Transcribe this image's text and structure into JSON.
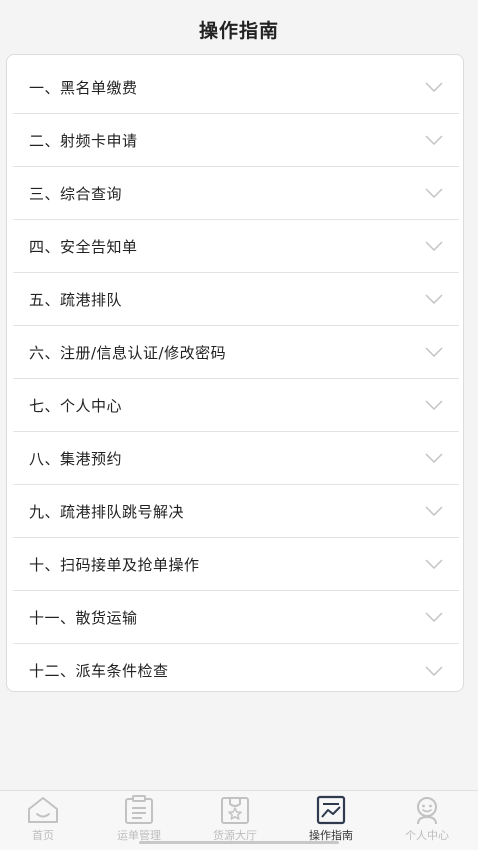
{
  "header": {
    "title": "操作指南"
  },
  "guide_items": [
    "一、黑名单缴费",
    "二、射频卡申请",
    "三、综合查询",
    "四、安全告知单",
    "五、疏港排队",
    "六、注册/信息认证/修改密码",
    "七、个人中心",
    "八、集港预约",
    "九、疏港排队跳号解决",
    "十、扫码接单及抢单操作",
    "十一、散货运输",
    "十二、派车条件检查"
  ],
  "tabbar": {
    "tabs": [
      {
        "label": "首页",
        "icon": "home-icon"
      },
      {
        "label": "运单管理",
        "icon": "clipboard-icon"
      },
      {
        "label": "货源大厅",
        "icon": "star-box-icon"
      },
      {
        "label": "操作指南",
        "icon": "chart-icon",
        "active": true
      },
      {
        "label": "个人中心",
        "icon": "person-icon"
      }
    ]
  },
  "colors": {
    "inactive": "#bdbdbd",
    "active": "#333333",
    "chevron": "#c4c4c4"
  }
}
